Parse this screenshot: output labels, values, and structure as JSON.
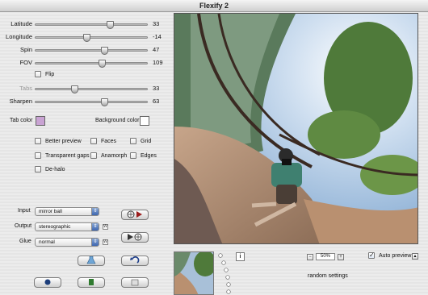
{
  "window": {
    "title": "Flexify 2"
  },
  "sliders": [
    {
      "label": "Latitude",
      "value": "33",
      "pos": 0.67,
      "dim": false
    },
    {
      "label": "Longitude",
      "value": "-14",
      "pos": 0.46,
      "dim": false
    },
    {
      "label": "Spin",
      "value": "47",
      "pos": 0.62,
      "dim": false
    },
    {
      "label": "FOV",
      "value": "109",
      "pos": 0.6,
      "dim": false
    },
    {
      "label": "Tabs",
      "value": "33",
      "pos": 0.35,
      "dim": true
    },
    {
      "label": "Sharpen",
      "value": "63",
      "pos": 0.62,
      "dim": false
    }
  ],
  "flip": {
    "label": "Flip",
    "checked": false
  },
  "tab_color": {
    "label": "Tab color",
    "color": "#c9a3d3"
  },
  "background_color": {
    "label": "Background color",
    "color": "#ffffff"
  },
  "options": {
    "better_preview": "Better preview",
    "faces": "Faces",
    "grid": "Grid",
    "transparent_gaps": "Transparent gaps",
    "anamorph": "Anamorph",
    "edges": "Edges",
    "de_halo": "De-halo"
  },
  "input": {
    "label": "Input",
    "value": "mirror ball"
  },
  "output": {
    "label": "Output",
    "value": "stereographic"
  },
  "glue": {
    "label": "Glue",
    "value": "normal"
  },
  "preview": {
    "zoom": "50%",
    "auto_preview_label": "Auto preview",
    "auto_preview_checked": true,
    "random_settings": "random settings",
    "info_icon": "i"
  },
  "icons": {
    "swap_forward": "swap-forward-icon",
    "swap_back": "swap-back-icon",
    "undo": "undo-icon",
    "flask": "flask-icon"
  }
}
